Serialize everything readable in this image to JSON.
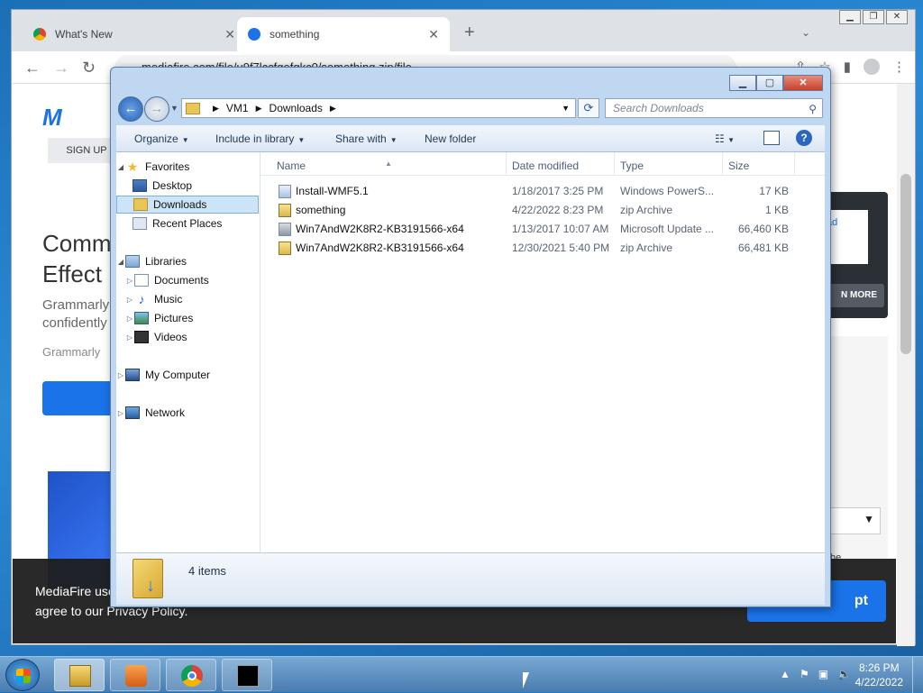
{
  "browser": {
    "tabs": [
      {
        "label": "What's New"
      },
      {
        "label": "something"
      }
    ],
    "url": "mediafire.com/file/u9f7lccfgefqkc0/something.zip/file",
    "page": {
      "logo": "M",
      "signup": "SIGN UP",
      "ad_heading_1": "Comm",
      "ad_heading_2": "Effect",
      "ad_sub_1": "Grammarly",
      "ad_sub_2": "confidently",
      "ad_brand": "Grammarly",
      "card_text": "ad",
      "more_btn": "N MORE",
      "side_text": "he"
    },
    "cookie": {
      "line1": "MediaFire use",
      "line2": "agree to our Privacy Policy.",
      "accept": "pt"
    }
  },
  "explorer": {
    "breadcrumb": [
      "VM1",
      "Downloads"
    ],
    "search_placeholder": "Search Downloads",
    "commands": {
      "organize": "Organize",
      "include": "Include in library",
      "share": "Share with",
      "newfolder": "New folder"
    },
    "nav": {
      "favorites": "Favorites",
      "desktop": "Desktop",
      "downloads": "Downloads",
      "recent": "Recent Places",
      "libraries": "Libraries",
      "documents": "Documents",
      "music": "Music",
      "pictures": "Pictures",
      "videos": "Videos",
      "computer": "My Computer",
      "network": "Network"
    },
    "columns": {
      "name": "Name",
      "date": "Date modified",
      "type": "Type",
      "size": "Size"
    },
    "files": [
      {
        "name": "Install-WMF5.1",
        "date": "1/18/2017 3:25 PM",
        "type": "Windows PowerS...",
        "size": "17 KB",
        "icon": "powershell-script-icon"
      },
      {
        "name": "something",
        "date": "4/22/2022 8:23 PM",
        "type": "zip Archive",
        "size": "1 KB",
        "icon": "zip-icon"
      },
      {
        "name": "Win7AndW2K8R2-KB3191566-x64",
        "date": "1/13/2017 10:07 AM",
        "type": "Microsoft Update ...",
        "size": "66,460 KB",
        "icon": "msu-icon"
      },
      {
        "name": "Win7AndW2K8R2-KB3191566-x64",
        "date": "12/30/2021 5:40 PM",
        "type": "zip Archive",
        "size": "66,481 KB",
        "icon": "zip-icon"
      }
    ],
    "status": "4 items"
  },
  "taskbar": {
    "time": "8:26 PM",
    "date": "4/22/2022"
  }
}
